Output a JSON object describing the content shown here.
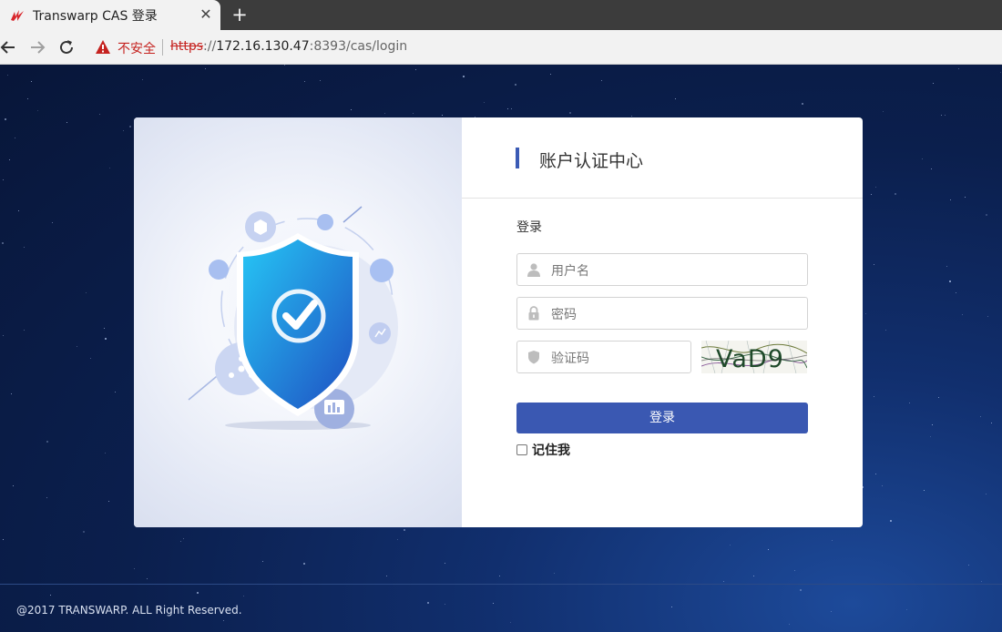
{
  "browser": {
    "tab_title": "Transwarp CAS 登录",
    "close_glyph": "✕",
    "new_tab_glyph": "+",
    "security_label": "不安全",
    "url": {
      "scheme": "https",
      "sep": "://",
      "host": "172.16.130.47",
      "rest": ":8393/cas/login"
    }
  },
  "card": {
    "header_title": "账户认证中心",
    "login_title": "登录",
    "username_placeholder": "用户名",
    "password_placeholder": "密码",
    "captcha_placeholder": "验证码",
    "captcha_text": "VaD9",
    "login_button": "登录",
    "remember_label": "记住我"
  },
  "footer": {
    "copyright": "@2017 TRANSWARP. ALL Right Reserved."
  },
  "icons": {
    "favicon": "transwarp-logo-icon",
    "back": "arrow-left-icon",
    "forward": "arrow-right-icon",
    "reload": "reload-icon",
    "warning": "warning-triangle-icon",
    "user": "user-icon",
    "lock": "lock-icon",
    "shield": "shield-icon"
  },
  "colors": {
    "accent": "#3a58b2",
    "insecure": "#c5221f",
    "page_bg": "#0b1f4d"
  }
}
